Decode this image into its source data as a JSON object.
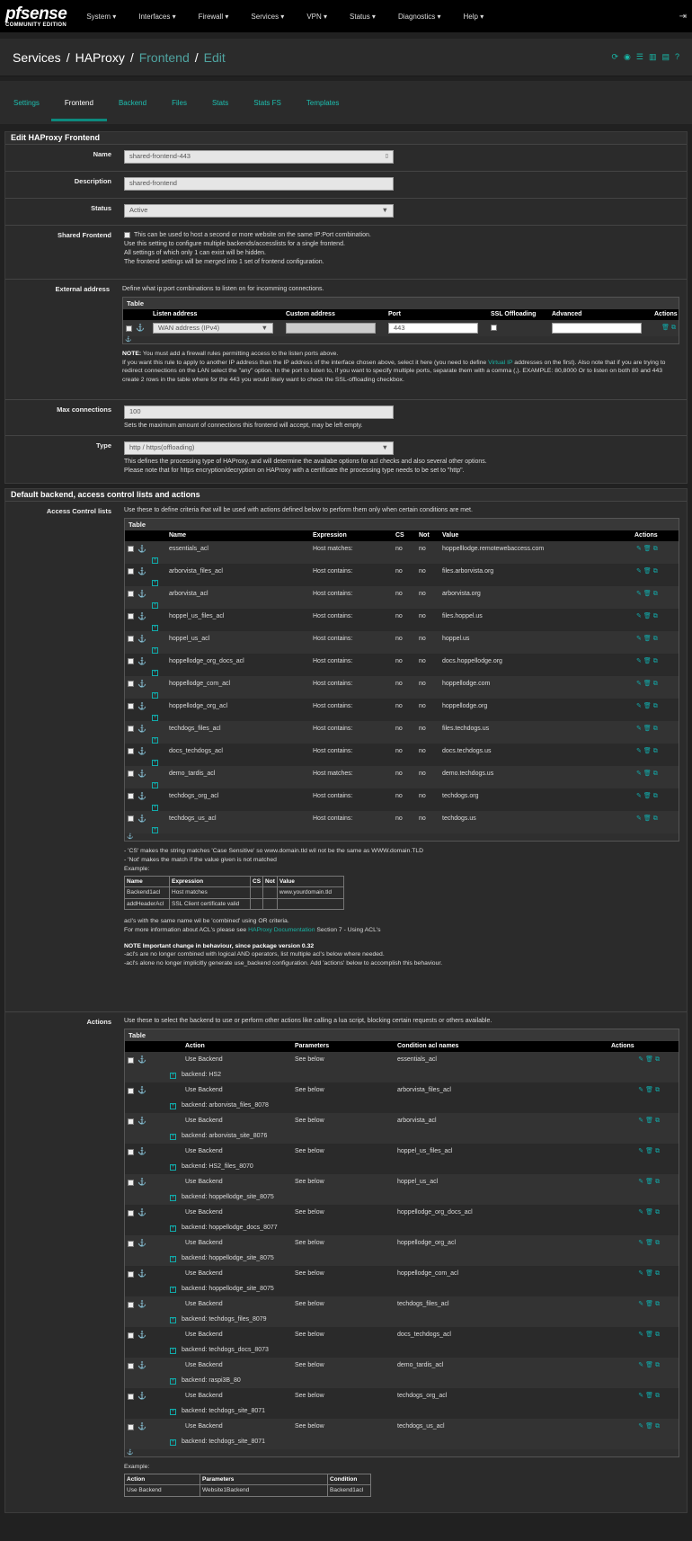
{
  "nav": {
    "logo_main": "pfsense",
    "logo_sub": "COMMUNITY EDITION",
    "menus": [
      "System ▾",
      "Interfaces ▾",
      "Firewall ▾",
      "Services ▾",
      "VPN ▾",
      "Status ▾",
      "Diagnostics ▾",
      "Help ▾"
    ],
    "logout": "⇥"
  },
  "crumb": {
    "a": "Services",
    "b": "HAProxy",
    "c": "Frontend",
    "d": "Edit",
    "sep": "/"
  },
  "tabs": [
    "Settings",
    "Frontend",
    "Backend",
    "Files",
    "Stats",
    "Stats FS",
    "Templates"
  ],
  "panel1": {
    "title": "Edit HAProxy Frontend",
    "name_label": "Name",
    "name_value": "shared-frontend-443",
    "desc_label": "Description",
    "desc_value": "shared-frontend",
    "status_label": "Status",
    "status_value": "Active",
    "shared_label": "Shared Frontend",
    "shared_text": "This can be used to host a second or more website on the same IP:Port combination.",
    "shared_help1": "Use this setting to configure multiple backends/accesslists for a single frontend.",
    "shared_help2": "All settings of which only 1 can exist will be hidden.",
    "shared_help3": "The frontend settings will be merged into 1 set of frontend configuration.",
    "ext_label": "External address",
    "ext_help": "Define what ip:port combinations to listen on for incomming connections.",
    "table": "Table",
    "ext_cols": [
      "Listen address",
      "Custom address",
      "Port",
      "SSL Offloading",
      "Advanced",
      "Actions"
    ],
    "ext_listen": "WAN address (IPv4)",
    "ext_port": "443",
    "note_bold": "NOTE:",
    "note1": " You must add a firewall rules permitting access to the listen ports above.",
    "note2a": "If you want this rule to apply to another IP address than the IP address of the interface chosen above, select it here (you need to define ",
    "note2link": "Virtual IP",
    "note2b": " addresses on the first). Also note that if you are trying to redirect connections on the LAN select the \"any\" option. In the port to listen to, if you want to specify multiple ports, separate them with a comma (,). EXAMPLE: 80,8000 Or to listen on both 80 and 443 create 2 rows in the table where for the 443 you would likely want to check the SSL-offloading checkbox.",
    "max_label": "Max connections",
    "max_value": "100",
    "max_help": "Sets the maximum amount of connections this frontend will accept, may be left empty.",
    "type_label": "Type",
    "type_value": "http / https(offloading)",
    "type_help1": "This defines the processing type of HAProxy, and will determine the availabe options for acl checks and also several other options.",
    "type_help2": "Please note that for https encryption/decryption on HAProxy with a certificate the processing type needs to be set to \"http\"."
  },
  "panel2": {
    "title": "Default backend, access control lists and actions",
    "acl_label": "Access Control lists",
    "acl_help": "Use these to define criteria that will be used with actions defined below to perform them only when certain conditions are met.",
    "acl_cols": [
      "Name",
      "Expression",
      "CS",
      "Not",
      "Value",
      "Actions"
    ],
    "acls": [
      [
        "essentials_acl",
        "Host matches:",
        "no",
        "no",
        "hoppelllodge.remotewebaccess.com"
      ],
      [
        "arborvista_files_acl",
        "Host contains:",
        "no",
        "no",
        "files.arborvista.org"
      ],
      [
        "arborvista_acl",
        "Host contains:",
        "no",
        "no",
        "arborvista.org"
      ],
      [
        "hoppel_us_files_acl",
        "Host contains:",
        "no",
        "no",
        "files.hoppel.us"
      ],
      [
        "hoppel_us_acl",
        "Host contains:",
        "no",
        "no",
        "hoppel.us"
      ],
      [
        "hoppellodge_org_docs_acl",
        "Host contains:",
        "no",
        "no",
        "docs.hoppellodge.org"
      ],
      [
        "hoppellodge_com_acl",
        "Host contains:",
        "no",
        "no",
        "hoppellodge.com"
      ],
      [
        "hoppellodge_org_acl",
        "Host contains:",
        "no",
        "no",
        "hoppellodge.org"
      ],
      [
        "techdogs_files_acl",
        "Host contains:",
        "no",
        "no",
        "files.techdogs.us"
      ],
      [
        "docs_techdogs_acl",
        "Host contains:",
        "no",
        "no",
        "docs.techdogs.us"
      ],
      [
        "demo_tardis_acl",
        "Host matches:",
        "no",
        "no",
        "demo.techdogs.us"
      ],
      [
        "techdogs_org_acl",
        "Host contains:",
        "no",
        "no",
        "techdogs.org"
      ],
      [
        "techdogs_us_acl",
        "Host contains:",
        "no",
        "no",
        "techdogs.us"
      ]
    ],
    "cs_note": "- 'CS' makes the string matches 'Case Sensitive' so www.domain.tld wil not be the same as WWW.domain.TLD",
    "not_note": "- 'Not' makes the match if the value given is not matched",
    "example": "Example:",
    "ex_cols": [
      "Name",
      "Expression",
      "CS",
      "Not",
      "Value"
    ],
    "ex_r1": [
      "Backend1acl",
      "Host matches",
      "",
      "",
      "www.yourdomain.tld"
    ],
    "ex_r2": [
      "addHeaderAcl",
      "SSL Client certificate valid",
      "",
      "",
      ""
    ],
    "combined": "acl's with the same name wil be 'combined' using OR criteria.",
    "moreinfo_a": "For more information about ACL's please see ",
    "moreinfo_link": "HAProxy Documentation",
    "moreinfo_b": " Section 7 - Using ACL's",
    "note_title": "NOTE Important change in behaviour, since package version 0.32",
    "note_l1": "-acl's are no longer combined with logical AND operators, list multiple acl's below where needed.",
    "note_l2": "-acl's alone no longer implicitly generate use_backend configuration. Add 'actions' below to accomplish this behaviour.",
    "act_label": "Actions",
    "act_help": "Use these to select the backend to use or perform other actions like calling a lua script, blocking certain requests or others available.",
    "act_cols": [
      "Action",
      "Parameters",
      "Condition acl names",
      "Actions"
    ],
    "actions": [
      [
        "Use Backend",
        "See below",
        "essentials_acl",
        "backend: HS2"
      ],
      [
        "Use Backend",
        "See below",
        "arborvista_files_acl",
        "backend: arborvista_files_8078"
      ],
      [
        "Use Backend",
        "See below",
        "arborvista_acl",
        "backend: arborvista_site_8076"
      ],
      [
        "Use Backend",
        "See below",
        "hoppel_us_files_acl",
        "backend: HS2_files_8070"
      ],
      [
        "Use Backend",
        "See below",
        "hoppel_us_acl",
        "backend: hoppellodge_site_8075"
      ],
      [
        "Use Backend",
        "See below",
        "hoppellodge_org_docs_acl",
        "backend: hoppellodge_docs_8077"
      ],
      [
        "Use Backend",
        "See below",
        "hoppellodge_org_acl",
        "backend: hoppellodge_site_8075"
      ],
      [
        "Use Backend",
        "See below",
        "hoppellodge_com_acl",
        "backend: hoppellodge_site_8075"
      ],
      [
        "Use Backend",
        "See below",
        "techdogs_files_acl",
        "backend: techdogs_files_8079"
      ],
      [
        "Use Backend",
        "See below",
        "docs_techdogs_acl",
        "backend: techdogs_docs_8073"
      ],
      [
        "Use Backend",
        "See below",
        "demo_tardis_acl",
        "backend: raspi3B_80"
      ],
      [
        "Use Backend",
        "See below",
        "techdogs_org_acl",
        "backend: techdogs_site_8071"
      ],
      [
        "Use Backend",
        "See below",
        "techdogs_us_acl",
        "backend: techdogs_site_8071"
      ]
    ],
    "act_ex_cols": [
      "Action",
      "Parameters",
      "Condition"
    ],
    "act_ex_r1": [
      "Use Backend",
      "Website1Backend",
      "Backend1acl"
    ]
  }
}
